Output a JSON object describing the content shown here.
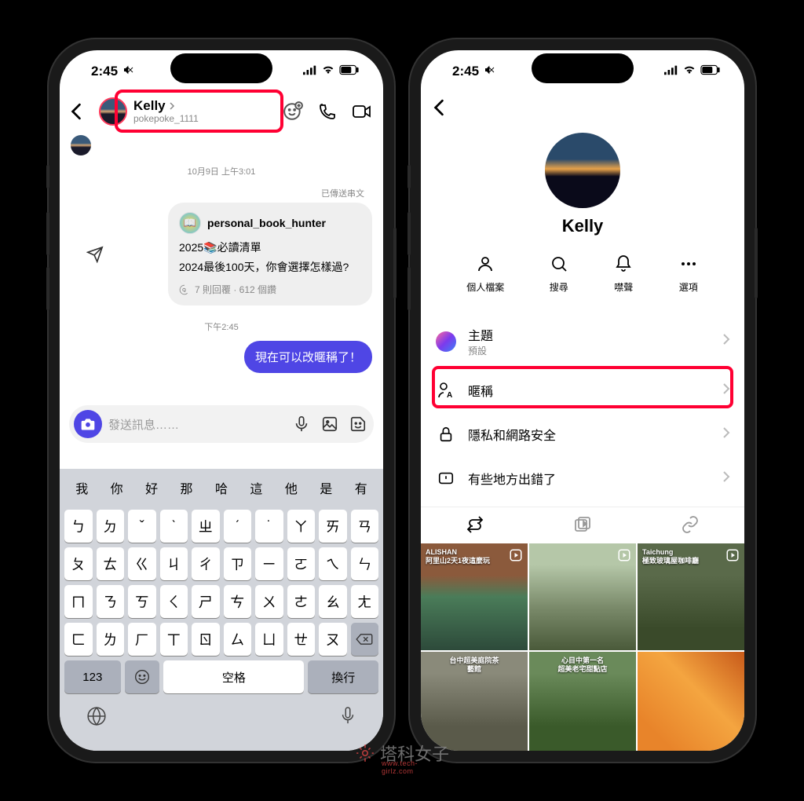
{
  "status": {
    "time": "2:45",
    "silent": true
  },
  "phone1": {
    "header": {
      "name": "Kelly",
      "username": "pokepoke_1111"
    },
    "chat": {
      "divider1": "10月9日 上午3:01",
      "sent_status": "已傳送串文",
      "shared": {
        "author": "personal_book_hunter",
        "line1": "2025📚必讀清單",
        "line2": "2024最後100天，你會選擇怎樣過?",
        "meta": "7 則回覆 · 612 個讚"
      },
      "divider2": "下午2:45",
      "sent_msg": "現在可以改暱稱了！"
    },
    "input": {
      "placeholder": "發送訊息……"
    },
    "keyboard": {
      "suggestions": [
        "我",
        "你",
        "好",
        "那",
        "哈",
        "這",
        "他",
        "是",
        "有"
      ],
      "row1": [
        "ㄅ",
        "ㄉ",
        "ˇ",
        "ˋ",
        "ㄓ",
        "ˊ",
        "˙",
        "ㄚ",
        "ㄞ",
        "ㄢ"
      ],
      "row2": [
        "ㄆ",
        "ㄊ",
        "ㄍ",
        "ㄐ",
        "ㄔ",
        "ㄗ",
        "ㄧ",
        "ㄛ",
        "ㄟ",
        "ㄣ"
      ],
      "row3": [
        "ㄇ",
        "ㄋ",
        "ㄎ",
        "ㄑ",
        "ㄕ",
        "ㄘ",
        "ㄨ",
        "ㄜ",
        "ㄠ",
        "ㄤ"
      ],
      "row4": [
        "ㄈ",
        "ㄌ",
        "ㄏ",
        "ㄒ",
        "ㄖ",
        "ㄙ",
        "ㄩ",
        "ㄝ",
        "ㄡ",
        "ㄥ"
      ],
      "num_key": "123",
      "space": "空格",
      "return": "換行"
    }
  },
  "phone2": {
    "name": "Kelly",
    "actions": {
      "profile": "個人檔案",
      "search": "搜尋",
      "mute": "噤聲",
      "options": "選項"
    },
    "list": {
      "theme": {
        "title": "主題",
        "sub": "預設"
      },
      "nickname": "暱稱",
      "privacy": "隱私和網路安全",
      "report": "有些地方出錯了"
    },
    "media": {
      "labels": [
        "ALISHAN\n阿里山2天1夜這麼玩",
        "",
        "Taichung\n極致玻璃屋咖啡廳",
        "台中超美庭院茶藝館",
        "心目中第一名\n超美老宅甜點店",
        ""
      ]
    }
  },
  "watermark": {
    "text": "塔科女子",
    "sub": "www.tech-girlz.com"
  }
}
